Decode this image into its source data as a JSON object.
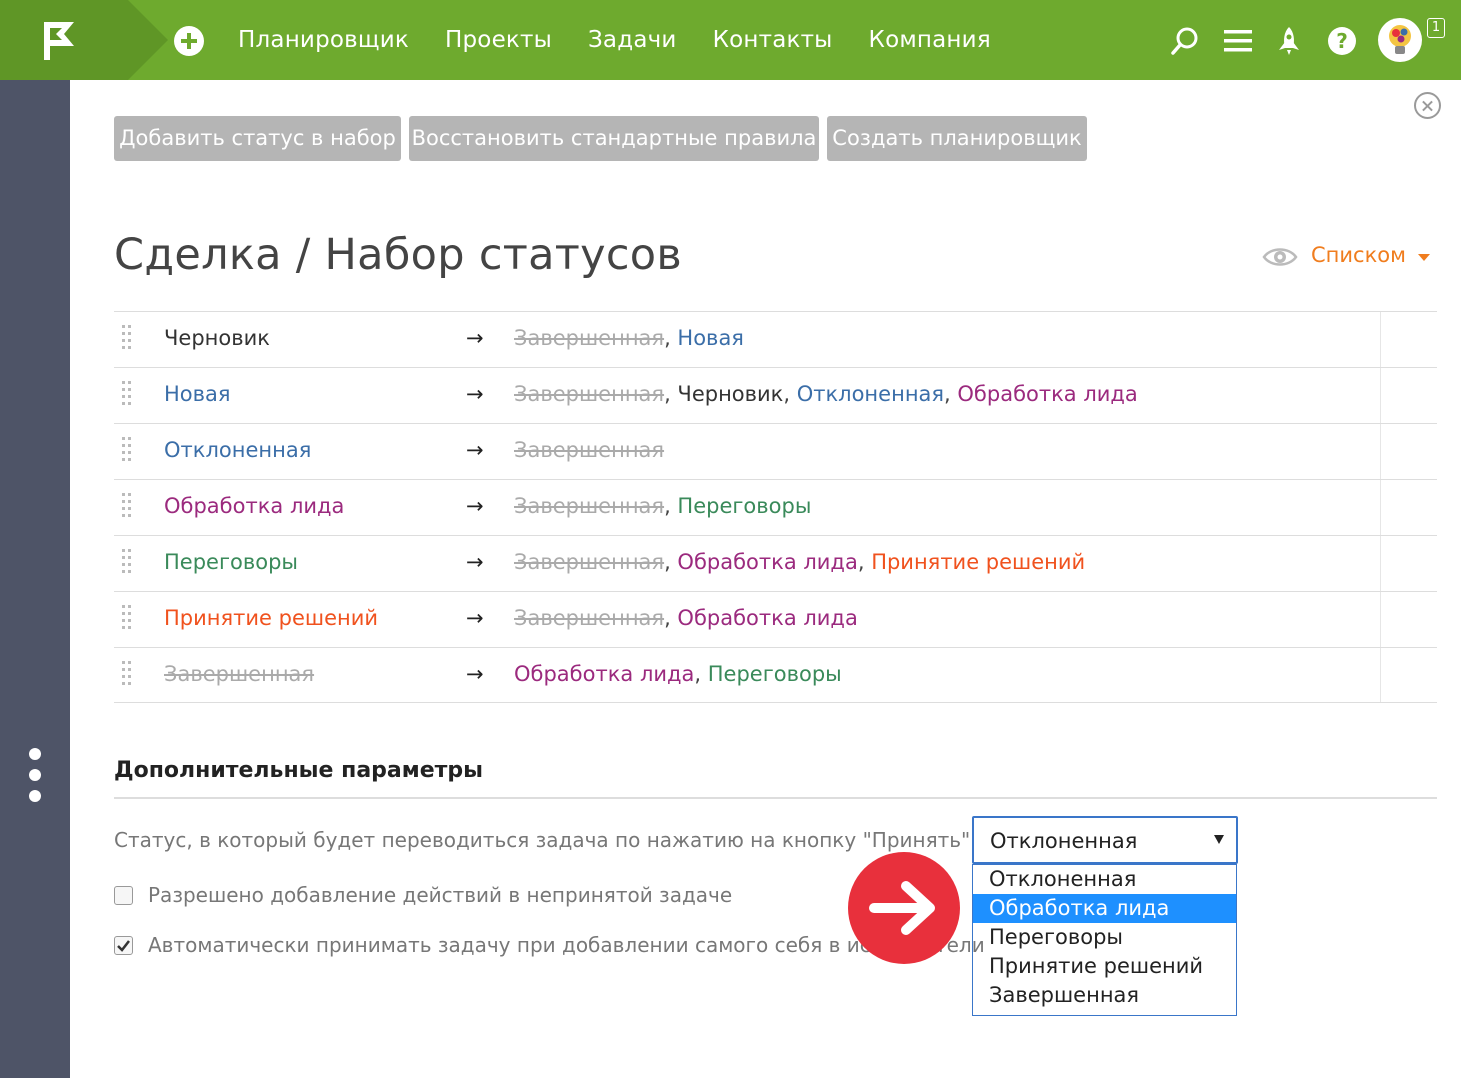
{
  "topbar": {
    "nav": [
      "Планировщик",
      "Проекты",
      "Задачи",
      "Контакты",
      "Компания"
    ],
    "notification_count": "1",
    "colors": {
      "bar": "#6eaa2e",
      "logo_bg": "#5f9626"
    },
    "icons": [
      "logo-flag-icon",
      "plus-icon",
      "search-icon",
      "menu-icon",
      "rocket-icon",
      "help-icon",
      "avatar"
    ]
  },
  "actions": {
    "add_status": "Добавить статус в набор",
    "restore_rules": "Восстановить стандартные правила",
    "create_planner": "Создать планировщик"
  },
  "page": {
    "title": "Сделка / Набор статусов",
    "view_mode": "Списком"
  },
  "statuses": [
    {
      "name": "Черновик",
      "targets": [
        "Завершенная",
        "Новая"
      ]
    },
    {
      "name": "Новая",
      "targets": [
        "Завершенная",
        "Черновик",
        "Отклоненная",
        "Обработка лида"
      ]
    },
    {
      "name": "Отклоненная",
      "targets": [
        "Завершенная"
      ]
    },
    {
      "name": "Обработка лида",
      "targets": [
        "Завершенная",
        "Переговоры"
      ]
    },
    {
      "name": "Переговоры",
      "targets": [
        "Завершенная",
        "Обработка лида",
        "Принятие решений"
      ]
    },
    {
      "name": "Принятие решений",
      "targets": [
        "Завершенная",
        "Обработка лида"
      ]
    },
    {
      "name": "Завершенная",
      "targets": [
        "Обработка лида",
        "Переговоры"
      ]
    }
  ],
  "status_colors": {
    "Черновик": "#333333",
    "Новая": "#3b6ea8",
    "Отклоненная": "#3b6ea8",
    "Обработка лида": "#9b2a7e",
    "Переговоры": "#3a8a5a",
    "Принятие решений": "#f0521e",
    "Завершенная": "#aaaaaa"
  },
  "arrow_glyph": "→",
  "params": {
    "title": "Дополнительные параметры",
    "accept_status_label": "Статус, в который будет переводиться задача по нажатию на кнопку \"Принять\":",
    "accept_status_value": "Отклоненная",
    "accept_status_options": [
      "Отклоненная",
      "Обработка лида",
      "Переговоры",
      "Принятие решений",
      "Завершенная"
    ],
    "accept_status_highlighted": "Обработка лида",
    "allow_actions_label": "Разрешено добавление действий в непринятой задаче",
    "allow_actions_checked": false,
    "auto_accept_label": "Автоматически принимать задачу при добавлении самого себя в исполнители",
    "auto_accept_checked": true
  }
}
